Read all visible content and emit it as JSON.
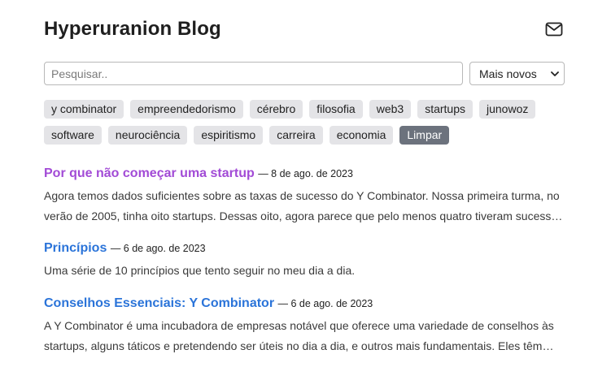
{
  "header": {
    "title": "Hyperuranion Blog",
    "mail_icon": "mail-icon"
  },
  "search": {
    "placeholder": "Pesquisar..",
    "value": ""
  },
  "sort": {
    "selected": "Mais novos"
  },
  "tags": {
    "row1": [
      "y combinator",
      "empreendedorismo",
      "cérebro",
      "filosofia",
      "web3",
      "startups",
      "junowoz"
    ],
    "row2": [
      "software",
      "neurociência",
      "espiritismo",
      "carreira",
      "economia"
    ],
    "clear_label": "Limpar"
  },
  "posts": [
    {
      "title": "Por que não começar uma startup",
      "date": "— 8 de ago. de 2023",
      "visited": true,
      "excerpt": [
        "Agora temos dados suficientes sobre as taxas de sucesso do Y Combinator. Nossa primeira turma, no",
        "verão de 2005, tinha oito startups. Dessas oito, agora parece que pelo menos quatro tiveram sucess…"
      ]
    },
    {
      "title": "Princípios",
      "date": "— 6 de ago. de 2023",
      "visited": false,
      "excerpt": [
        "Uma série de 10 princípios que tento seguir no meu dia a dia."
      ]
    },
    {
      "title": "Conselhos Essenciais: Y Combinator",
      "date": "— 6 de ago. de 2023",
      "visited": false,
      "excerpt": [
        "A Y Combinator é uma incubadora de empresas notável que oferece uma variedade de conselhos às",
        "startups, alguns táticos e pretendendo ser úteis no dia a dia, e outros mais fundamentais. Eles têm…"
      ]
    }
  ],
  "colors": {
    "link": "#2b74d9",
    "visited_link": "#a24bd6",
    "tag_bg": "#e4e4e7",
    "clear_bg": "#6c727d"
  }
}
